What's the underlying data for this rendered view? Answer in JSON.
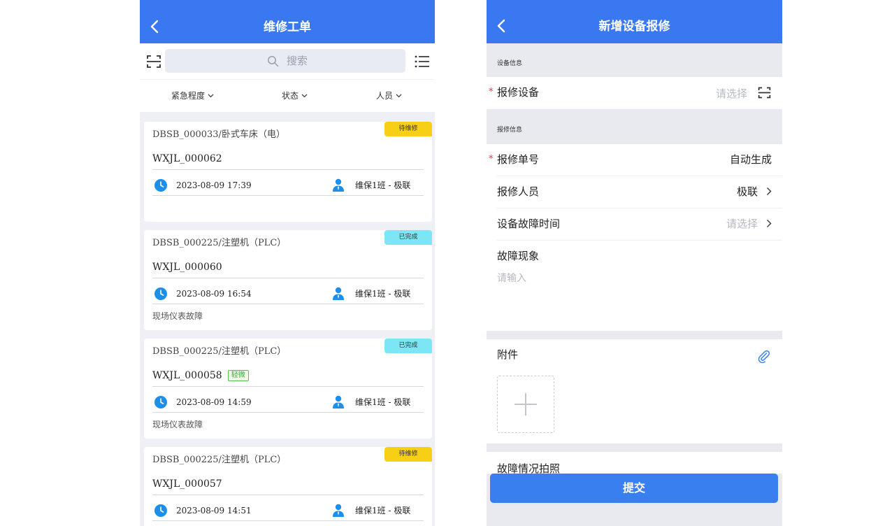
{
  "left": {
    "title": "维修工单",
    "search_placeholder": "搜索",
    "filters": [
      {
        "label": "紧急程度"
      },
      {
        "label": "状态"
      },
      {
        "label": "人员"
      }
    ],
    "orders": [
      {
        "equipment": "DBSB_000033/卧式车床（电）",
        "status": "待维修",
        "status_type": "pending",
        "code": "WXJL_000062",
        "badge": "",
        "time": "2023-08-09 17:39",
        "team": "维保1班 -  极联",
        "desc": ""
      },
      {
        "equipment": "DBSB_000225/注塑机（PLC）",
        "status": "已完成",
        "status_type": "done",
        "code": "WXJL_000060",
        "badge": "",
        "time": "2023-08-09 16:54",
        "team": "维保1班 -  极联",
        "desc": "现场仪表故障"
      },
      {
        "equipment": "DBSB_000225/注塑机（PLC）",
        "status": "已完成",
        "status_type": "done",
        "code": "WXJL_000058",
        "badge": "轻微",
        "time": "2023-08-09 14:59",
        "team": "维保1班 -  极联",
        "desc": "现场仪表故障"
      },
      {
        "equipment": "DBSB_000225/注塑机（PLC）",
        "status": "待维修",
        "status_type": "pending",
        "code": "WXJL_000057",
        "badge": "",
        "time": "2023-08-09 14:51",
        "team": "维保1班 -  极联",
        "desc": ""
      }
    ],
    "colors": {
      "nav": "#3a78f2",
      "pending": "#f7cf14",
      "done": "#7de6f5",
      "icon": "#1e8fe8"
    }
  },
  "right": {
    "title": "新增设备报修",
    "section_equipment": "设备信息",
    "section_report": "报修信息",
    "required_mark": "*",
    "fields": {
      "device": {
        "label": "报修设备",
        "placeholder": "请选择"
      },
      "order_no": {
        "label": "报修单号",
        "value": "自动生成"
      },
      "reporter": {
        "label": "报修人员",
        "value": "极联"
      },
      "fault_time": {
        "label": "设备故障时间",
        "placeholder": "请选择"
      },
      "symptom": {
        "label": "故障现象",
        "placeholder": "请输入"
      }
    },
    "attachment_label": "附件",
    "photo_label": "故障情况拍照",
    "submit_label": "提交",
    "icons": [
      "back-icon",
      "scan-icon",
      "chevron-right-icon",
      "paperclip-icon",
      "plus-icon"
    ]
  }
}
